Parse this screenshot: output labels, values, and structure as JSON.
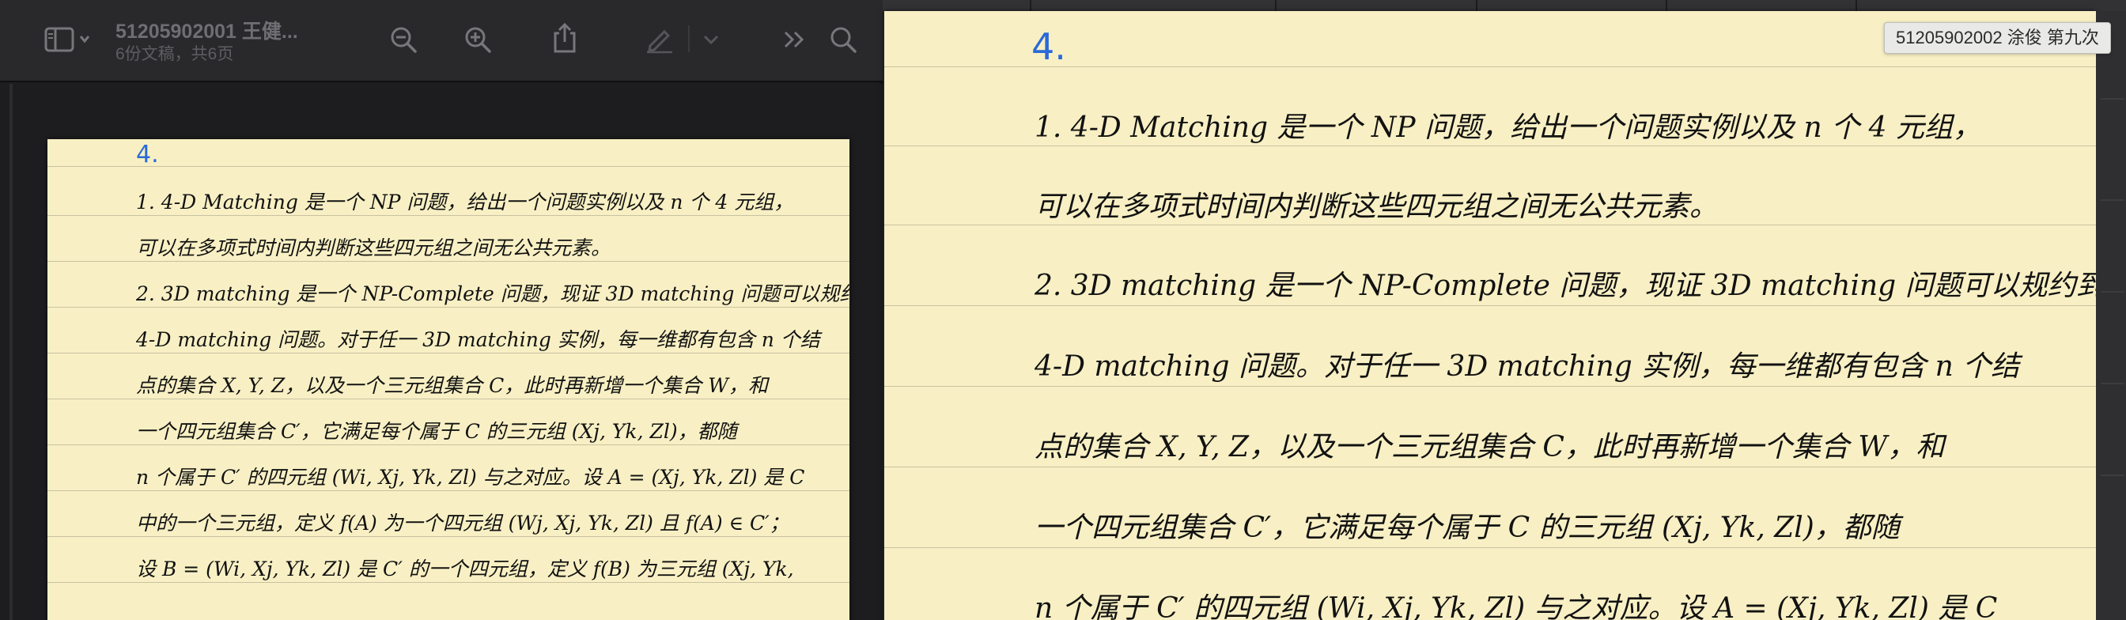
{
  "toolbar": {
    "doc_title": "51205902001 王健...",
    "doc_subtitle": "6份文稿，共6页",
    "icons": {
      "sidebar": "sidebar-icon",
      "zoom_out": "zoom-out-icon",
      "zoom_in": "zoom-in-icon",
      "share": "share-icon",
      "markup": "pen-icon",
      "more": "chevron-double-right-icon",
      "search": "search-icon"
    }
  },
  "tooltip": {
    "text": "51205902002 涂俊 第九次"
  },
  "handwriting": {
    "heading": "4.",
    "lines": [
      "1. 4-D Matching 是一个 NP 问题，给出一个问题实例以及 n 个 4 元组，",
      "可以在多项式时间内判断这些四元组之间无公共元素。",
      "2. 3D matching 是一个 NP-Complete 问题，现证 3D matching 问题可以规约到",
      "4-D matching 问题。对于任一 3D matching 实例，每一维都有包含 n 个结",
      "点的集合 X, Y, Z，以及一个三元组集合 C，此时再新增一个集合 W，和",
      "一个四元组集合 C′，它满足每个属于 C 的三元组 (Xj, Yk, Zl)，都随",
      "n 个属于 C′ 的四元组 (Wi, Xj, Yk, Zl) 与之对应。设 A = (Xj, Yk, Zl) 是 C",
      "中的一个三元组，定义 f(A) 为一个四元组 (Wj, Xj, Yk, Zl) 且 f(A) ∈ C′；",
      "设 B = (Wi, Xj, Yk, Zl) 是 C′ 的一个四元组，定义 f(B) 为三元组 (Xj, Yk,"
    ]
  },
  "colors": {
    "paper": "#f8f0c4",
    "ink": "#121212",
    "heading_ink": "#2a6ad8",
    "toolbar_bg": "#29292b",
    "window_bg": "#1d1d1f"
  }
}
